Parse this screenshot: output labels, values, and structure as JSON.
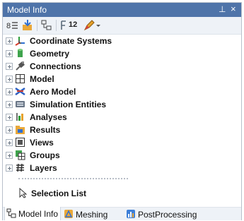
{
  "panel": {
    "title": "Model Info",
    "pin_glyph": "⊥",
    "close_glyph": "×"
  },
  "toolbar": {
    "count_label": "12"
  },
  "tree": {
    "items": [
      {
        "label": "Coordinate Systems",
        "icon": "axes-icon"
      },
      {
        "label": "Geometry",
        "icon": "cylinder-icon"
      },
      {
        "label": "Connections",
        "icon": "connector-icon"
      },
      {
        "label": "Model",
        "icon": "grid-icon"
      },
      {
        "label": "Aero Model",
        "icon": "aero-icon"
      },
      {
        "label": "Simulation Entities",
        "icon": "simulation-icon"
      },
      {
        "label": "Analyses",
        "icon": "analysis-icon"
      },
      {
        "label": "Results",
        "icon": "results-icon"
      },
      {
        "label": "Views",
        "icon": "view-icon"
      },
      {
        "label": "Groups",
        "icon": "groups-icon"
      },
      {
        "label": "Layers",
        "icon": "layers-icon"
      }
    ],
    "selection_list": {
      "label": "Selection List",
      "icon": "cursor-icon"
    }
  },
  "tabs": [
    {
      "label": "Model Info",
      "icon": "model-info-icon",
      "active": true
    },
    {
      "label": "Meshing",
      "icon": "meshing-icon",
      "active": false
    },
    {
      "label": "PostProcessing",
      "icon": "postprocessing-icon",
      "active": false
    }
  ],
  "colors": {
    "title_bar": "#4f74a9",
    "toolbar_bg": "#eef2f7"
  }
}
